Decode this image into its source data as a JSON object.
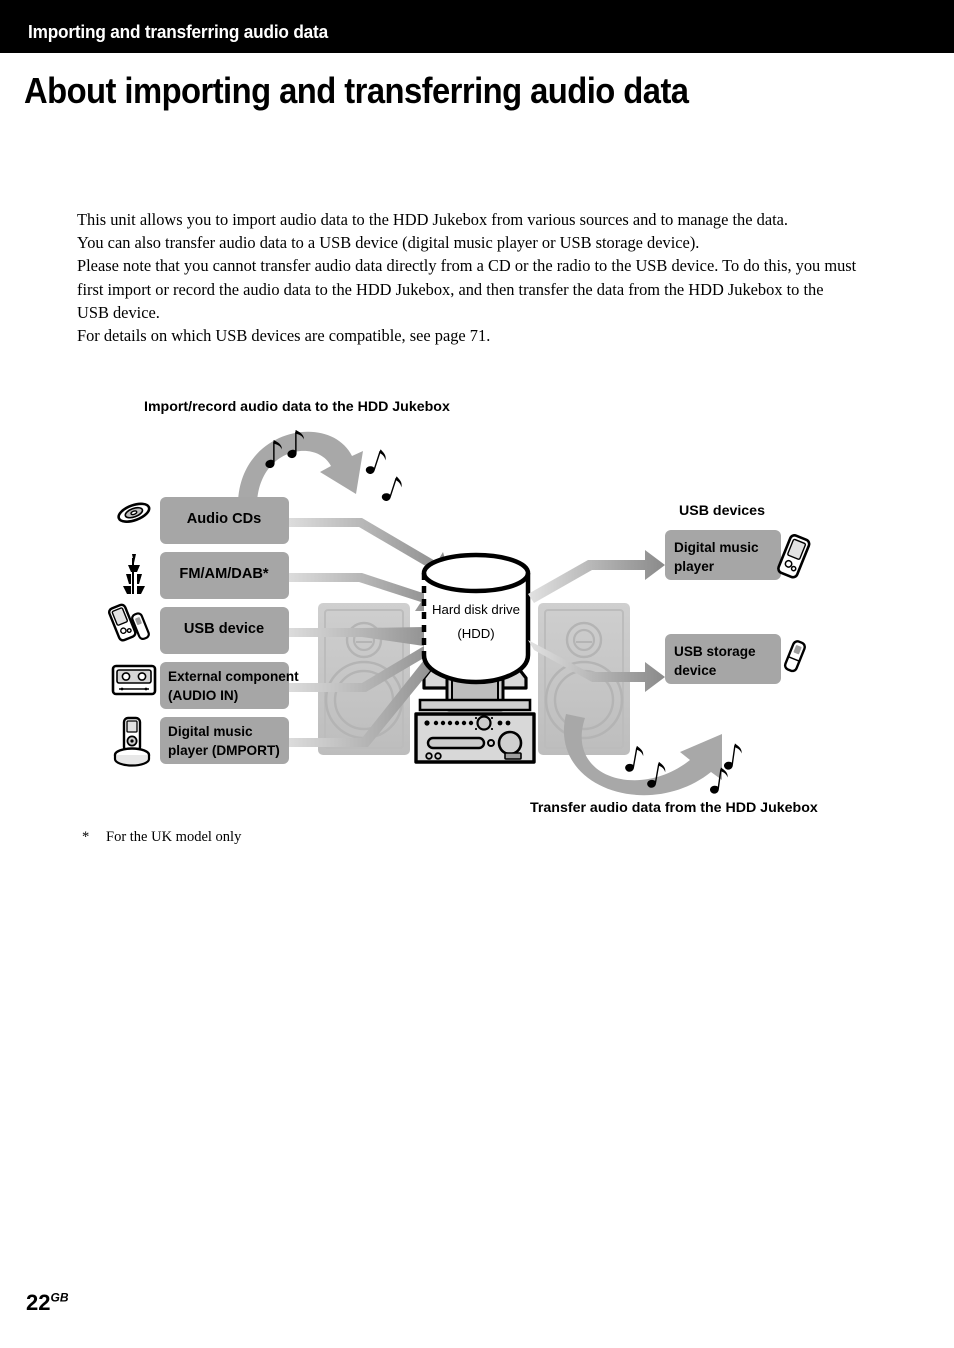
{
  "header": {
    "running_title": "Importing and transferring audio data"
  },
  "title": "About importing and transferring audio data",
  "intro": {
    "paragraphs": [
      "This unit allows you to import audio data to the HDD Jukebox from various sources and to manage the data.",
      "You can also transfer audio data to a USB device (digital music player or USB storage device).",
      "Please note that you cannot transfer audio data directly from a CD or the radio to the USB device. To do this, you must first import or record the audio data to the HDD Jukebox, and then transfer the data from the HDD Jukebox to the USB device.",
      "For details on which USB devices are compatible, see page 71."
    ]
  },
  "diagram": {
    "top_caption": "Import/record audio data to the HDD Jukebox",
    "bottom_caption": "Transfer audio data from the HDD Jukebox",
    "usb_devices_heading": "USB devices",
    "hdd": {
      "line1": "Hard disk drive",
      "line2": "(HDD)"
    },
    "sources": [
      {
        "label": "Audio CDs",
        "icon": "compact-disc-icon",
        "lines": [
          "Audio CDs"
        ],
        "align": "center"
      },
      {
        "label": "FM/AM/DAB*",
        "icon": "antenna-icon",
        "lines": [
          "FM/AM/DAB*"
        ],
        "align": "center"
      },
      {
        "label": "USB device",
        "icon": "usb-devices-icon",
        "lines": [
          "USB device"
        ],
        "align": "center"
      },
      {
        "label": "External component (AUDIO IN)",
        "icon": "cassette-tape-icon",
        "lines": [
          "External component",
          "(AUDIO IN)"
        ],
        "align": "left"
      },
      {
        "label": "Digital music player (DMPORT)",
        "icon": "dmport-cradle-icon",
        "lines": [
          "Digital music",
          "player (DMPORT)"
        ],
        "align": "left"
      }
    ],
    "destinations": [
      {
        "label": "Digital music player",
        "icon": "digital-music-player-icon",
        "lines": [
          "Digital music",
          "player"
        ]
      },
      {
        "label": "USB storage device",
        "icon": "usb-flash-drive-icon",
        "lines": [
          "USB storage",
          "device"
        ]
      }
    ],
    "colors": {
      "box_fill": "#a6a6a6",
      "arrow_gray": "#8c8c8c",
      "arrow_light": "#d4d4d4",
      "speaker_gray": "#c9c9c9",
      "outline": "#000000"
    }
  },
  "footnote": {
    "mark": "*",
    "text": "For the UK model only"
  },
  "page_number": {
    "number": "22",
    "suffix": "GB"
  }
}
